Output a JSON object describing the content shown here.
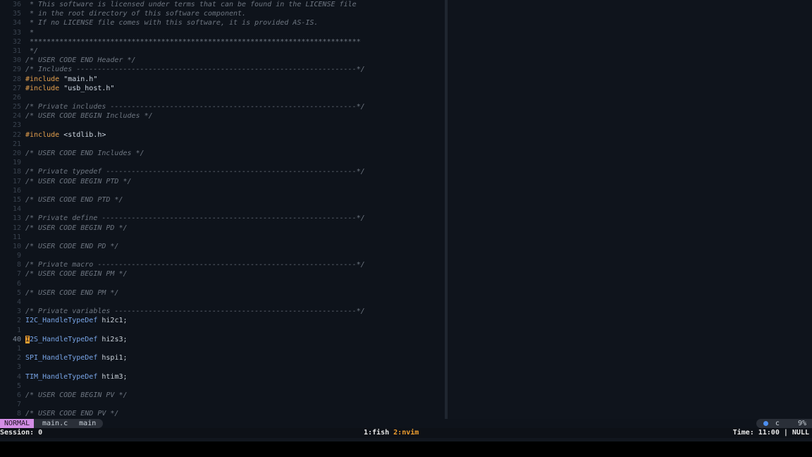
{
  "editor": {
    "lines": [
      {
        "num": "36",
        "segments": [
          {
            "cls": "t-comment",
            "text": " * This software is licensed under terms that can be found in the LICENSE file"
          }
        ]
      },
      {
        "num": "35",
        "segments": [
          {
            "cls": "t-comment",
            "text": " * in the root directory of this software component."
          }
        ]
      },
      {
        "num": "34",
        "segments": [
          {
            "cls": "t-comment",
            "text": " * If no LICENSE file comes with this software, it is provided AS-IS."
          }
        ]
      },
      {
        "num": "33",
        "segments": [
          {
            "cls": "t-comment",
            "text": " *"
          }
        ]
      },
      {
        "num": "32",
        "segments": [
          {
            "cls": "t-comment",
            "text": " ******************************************************************************"
          }
        ]
      },
      {
        "num": "31",
        "segments": [
          {
            "cls": "t-comment",
            "text": " */"
          }
        ]
      },
      {
        "num": "30",
        "segments": [
          {
            "cls": "t-comment",
            "text": "/* USER CODE END Header */"
          }
        ]
      },
      {
        "num": "29",
        "segments": [
          {
            "cls": "t-comment",
            "text": "/* Includes ------------------------------------------------------------------*/"
          }
        ]
      },
      {
        "num": "28",
        "segments": [
          {
            "cls": "t-pre",
            "text": "#include "
          },
          {
            "cls": "t-str",
            "text": "\"main.h\""
          }
        ]
      },
      {
        "num": "27",
        "segments": [
          {
            "cls": "t-pre",
            "text": "#include "
          },
          {
            "cls": "t-str",
            "text": "\"usb_host.h\""
          }
        ]
      },
      {
        "num": "26",
        "segments": []
      },
      {
        "num": "25",
        "segments": [
          {
            "cls": "t-comment",
            "text": "/* Private includes ----------------------------------------------------------*/"
          }
        ]
      },
      {
        "num": "24",
        "segments": [
          {
            "cls": "t-comment",
            "text": "/* USER CODE BEGIN Includes */"
          }
        ]
      },
      {
        "num": "23",
        "segments": []
      },
      {
        "num": "22",
        "segments": [
          {
            "cls": "t-pre",
            "text": "#include "
          },
          {
            "cls": "t-str",
            "text": "<stdlib.h>"
          }
        ]
      },
      {
        "num": "21",
        "segments": []
      },
      {
        "num": "20",
        "segments": [
          {
            "cls": "t-comment",
            "text": "/* USER CODE END Includes */"
          }
        ]
      },
      {
        "num": "19",
        "segments": []
      },
      {
        "num": "18",
        "segments": [
          {
            "cls": "t-comment",
            "text": "/* Private typedef -----------------------------------------------------------*/"
          }
        ]
      },
      {
        "num": "17",
        "segments": [
          {
            "cls": "t-comment",
            "text": "/* USER CODE BEGIN PTD */"
          }
        ]
      },
      {
        "num": "16",
        "segments": []
      },
      {
        "num": "15",
        "segments": [
          {
            "cls": "t-comment",
            "text": "/* USER CODE END PTD */"
          }
        ]
      },
      {
        "num": "14",
        "segments": []
      },
      {
        "num": "13",
        "segments": [
          {
            "cls": "t-comment",
            "text": "/* Private define ------------------------------------------------------------*/"
          }
        ]
      },
      {
        "num": "12",
        "segments": [
          {
            "cls": "t-comment",
            "text": "/* USER CODE BEGIN PD */"
          }
        ]
      },
      {
        "num": "11",
        "segments": []
      },
      {
        "num": "10",
        "segments": [
          {
            "cls": "t-comment",
            "text": "/* USER CODE END PD */"
          }
        ]
      },
      {
        "num": "9",
        "segments": []
      },
      {
        "num": "8",
        "segments": [
          {
            "cls": "t-comment",
            "text": "/* Private macro -------------------------------------------------------------*/"
          }
        ]
      },
      {
        "num": "7",
        "segments": [
          {
            "cls": "t-comment",
            "text": "/* USER CODE BEGIN PM */"
          }
        ]
      },
      {
        "num": "6",
        "segments": []
      },
      {
        "num": "5",
        "segments": [
          {
            "cls": "t-comment",
            "text": "/* USER CODE END PM */"
          }
        ]
      },
      {
        "num": "4",
        "segments": []
      },
      {
        "num": "3",
        "segments": [
          {
            "cls": "t-comment",
            "text": "/* Private variables ---------------------------------------------------------*/"
          }
        ]
      },
      {
        "num": "2",
        "segments": [
          {
            "cls": "t-type",
            "text": "I2C_HandleTypeDef"
          },
          {
            "cls": "t-plain",
            "text": " hi2c1;"
          }
        ]
      },
      {
        "num": "1",
        "segments": []
      },
      {
        "num": "40",
        "current": true,
        "segments": [
          {
            "cls": "t-cursor",
            "text": "I"
          },
          {
            "cls": "t-type",
            "text": "2S_HandleTypeDef"
          },
          {
            "cls": "t-plain",
            "text": " hi2s3;"
          }
        ]
      },
      {
        "num": "1",
        "segments": []
      },
      {
        "num": "2",
        "segments": [
          {
            "cls": "t-type",
            "text": "SPI_HandleTypeDef"
          },
          {
            "cls": "t-plain",
            "text": " hspi1;"
          }
        ]
      },
      {
        "num": "3",
        "segments": []
      },
      {
        "num": "4",
        "segments": [
          {
            "cls": "t-type",
            "text": "TIM_HandleTypeDef"
          },
          {
            "cls": "t-plain",
            "text": " htim3;"
          }
        ]
      },
      {
        "num": "5",
        "segments": []
      },
      {
        "num": "6",
        "segments": [
          {
            "cls": "t-comment",
            "text": "/* USER CODE BEGIN PV */"
          }
        ]
      },
      {
        "num": "7",
        "segments": []
      },
      {
        "num": "8",
        "segments": [
          {
            "cls": "t-comment",
            "text": "/* USER CODE END PV */"
          }
        ]
      }
    ]
  },
  "statusline": {
    "mode": "NORMAL",
    "filename": "main.c",
    "branch_icon": "",
    "branch": "main",
    "language_icon": "c-language-icon",
    "language": "c",
    "progress": "9%"
  },
  "tmux": {
    "session": "Session: 0",
    "window1": "1:fish",
    "window2": "2:nvim",
    "right": "Time: 11:00 | NULL"
  },
  "colors": {
    "mode_badge": "#d48ee6",
    "active_window": "#f0a030",
    "cursor": "#f0a030",
    "comment": "#6e7681",
    "preprocessor": "#e5a04d",
    "type": "#78a4e6"
  }
}
